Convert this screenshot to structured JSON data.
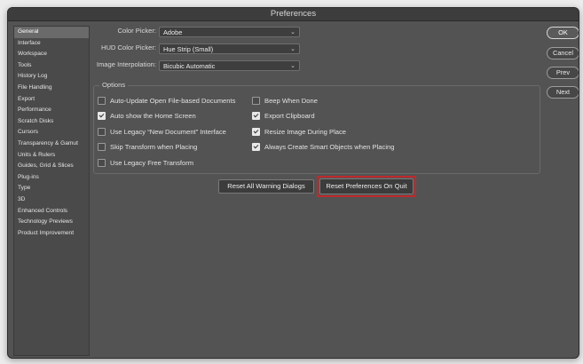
{
  "window": {
    "title": "Preferences"
  },
  "sidebar": {
    "items": [
      {
        "label": "General",
        "selected": true
      },
      {
        "label": "Interface"
      },
      {
        "label": "Workspace"
      },
      {
        "label": "Tools"
      },
      {
        "label": "History Log"
      },
      {
        "label": "File Handling"
      },
      {
        "label": "Export"
      },
      {
        "label": "Performance"
      },
      {
        "label": "Scratch Disks"
      },
      {
        "label": "Cursors"
      },
      {
        "label": "Transparency & Gamut"
      },
      {
        "label": "Units & Rulers"
      },
      {
        "label": "Guides, Grid & Slices"
      },
      {
        "label": "Plug-ins"
      },
      {
        "label": "Type"
      },
      {
        "label": "3D"
      },
      {
        "label": "Enhanced Controls"
      },
      {
        "label": "Technology Previews"
      },
      {
        "label": "Product Improvement"
      }
    ]
  },
  "general": {
    "color_picker": {
      "label": "Color Picker:",
      "value": "Adobe"
    },
    "hud_color_picker": {
      "label": "HUD Color Picker:",
      "value": "Hue Strip (Small)"
    },
    "image_interpolation": {
      "label": "Image Interpolation:",
      "value": "Bicubic Automatic"
    }
  },
  "options": {
    "title": "Options",
    "left": [
      {
        "label": "Auto-Update Open File-based Documents",
        "checked": false
      },
      {
        "label": "Auto show the Home Screen",
        "checked": true
      },
      {
        "label": "Use Legacy “New Document” Interface",
        "checked": false
      },
      {
        "label": "Skip Transform when Placing",
        "checked": false
      },
      {
        "label": "Use Legacy Free Transform",
        "checked": false
      }
    ],
    "right": [
      {
        "label": "Beep When Done",
        "checked": false
      },
      {
        "label": "Export Clipboard",
        "checked": true
      },
      {
        "label": "Resize Image During Place",
        "checked": true
      },
      {
        "label": "Always Create Smart Objects when Placing",
        "checked": true
      }
    ]
  },
  "actions": {
    "reset_warnings": "Reset All Warning Dialogs",
    "reset_prefs": "Reset Preferences On Quit"
  },
  "side_buttons": {
    "ok": "OK",
    "cancel": "Cancel",
    "prev": "Prev",
    "next": "Next"
  },
  "colors": {
    "highlight": "#c0292c",
    "panel": "#535353",
    "selected": "#6a6a6a"
  }
}
